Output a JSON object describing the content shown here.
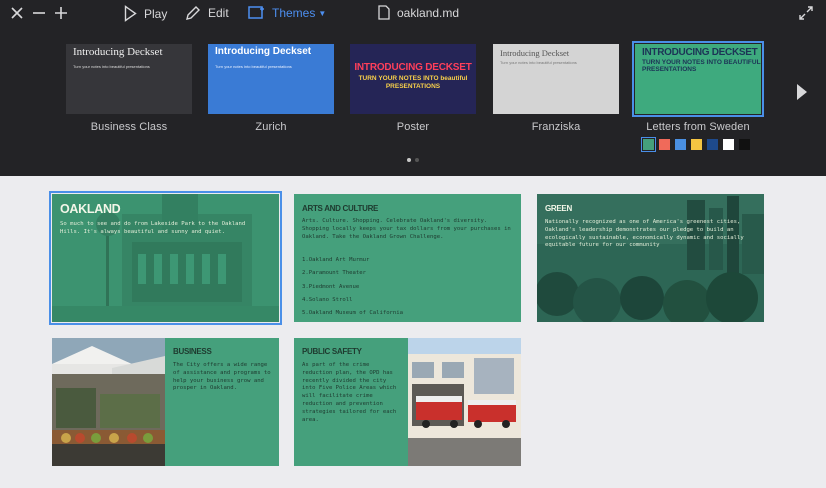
{
  "toolbar": {
    "play_label": "Play",
    "edit_label": "Edit",
    "themes_label": "Themes",
    "file_name": "oakland.md"
  },
  "themes": [
    {
      "name": "Business Class",
      "title": "Introducing Deckset",
      "subtitle": "Turn your notes into beautiful presentations"
    },
    {
      "name": "Zurich",
      "title": "Introducing Deckset",
      "subtitle": "Turn your notes into beautiful presentations"
    },
    {
      "name": "Poster",
      "title": "INTRODUCING DECKSET",
      "subtitle": "TURN YOUR NOTES INTO beautiful PRESENTATIONS"
    },
    {
      "name": "Franziska",
      "title": "Introducing Deckset",
      "subtitle": "Turn your notes into beautiful presentations"
    },
    {
      "name": "Letters from Sweden",
      "title": "INTRODUCING DECKSET",
      "subtitle": "TURN YOUR NOTES INTO BEAUTIFUL PRESENTATIONS",
      "selected": true
    }
  ],
  "color_swatches": [
    "#45a07c",
    "#f06a5a",
    "#4a90e2",
    "#f5c542",
    "#1e4a8c",
    "#ffffff",
    "#111111"
  ],
  "slides": [
    {
      "title": "OAKLAND",
      "body": "So much to see and do from Lakeside Park to the Oakland Hills. It's always beautiful and sunny and quiet."
    },
    {
      "title": "ARTS AND CULTURE",
      "body": "Arts. Culture. Shopping. Celebrate Oakland's diversity. Shopping locally keeps your tax dollars from your purchases in Oakland. Take the Oakland Grown Challenge.",
      "items": [
        "1.Oakland Art Murmur",
        "2.Paramount Theater",
        "3.Piedmont Avenue",
        "4.Solano Stroll",
        "5.Oakland Museum of California"
      ]
    },
    {
      "title": "GREEN",
      "body": "Nationally recognized as one of America's greenest cities, Oakland's leadership demonstrates our pledge to build an ecologically sustainable, economically dynamic and socially equitable future for our community"
    },
    {
      "title": "BUSINESS",
      "body": "The City offers a wide range of assistance and programs to help your business grow and prosper in Oakland."
    },
    {
      "title": "PUBLIC SAFETY",
      "body": "As part of the crime reduction plan, the OPD has recently divided the city into Five Police Areas which will facilitate crime reduction and prevention strategies tailored for each area."
    }
  ]
}
